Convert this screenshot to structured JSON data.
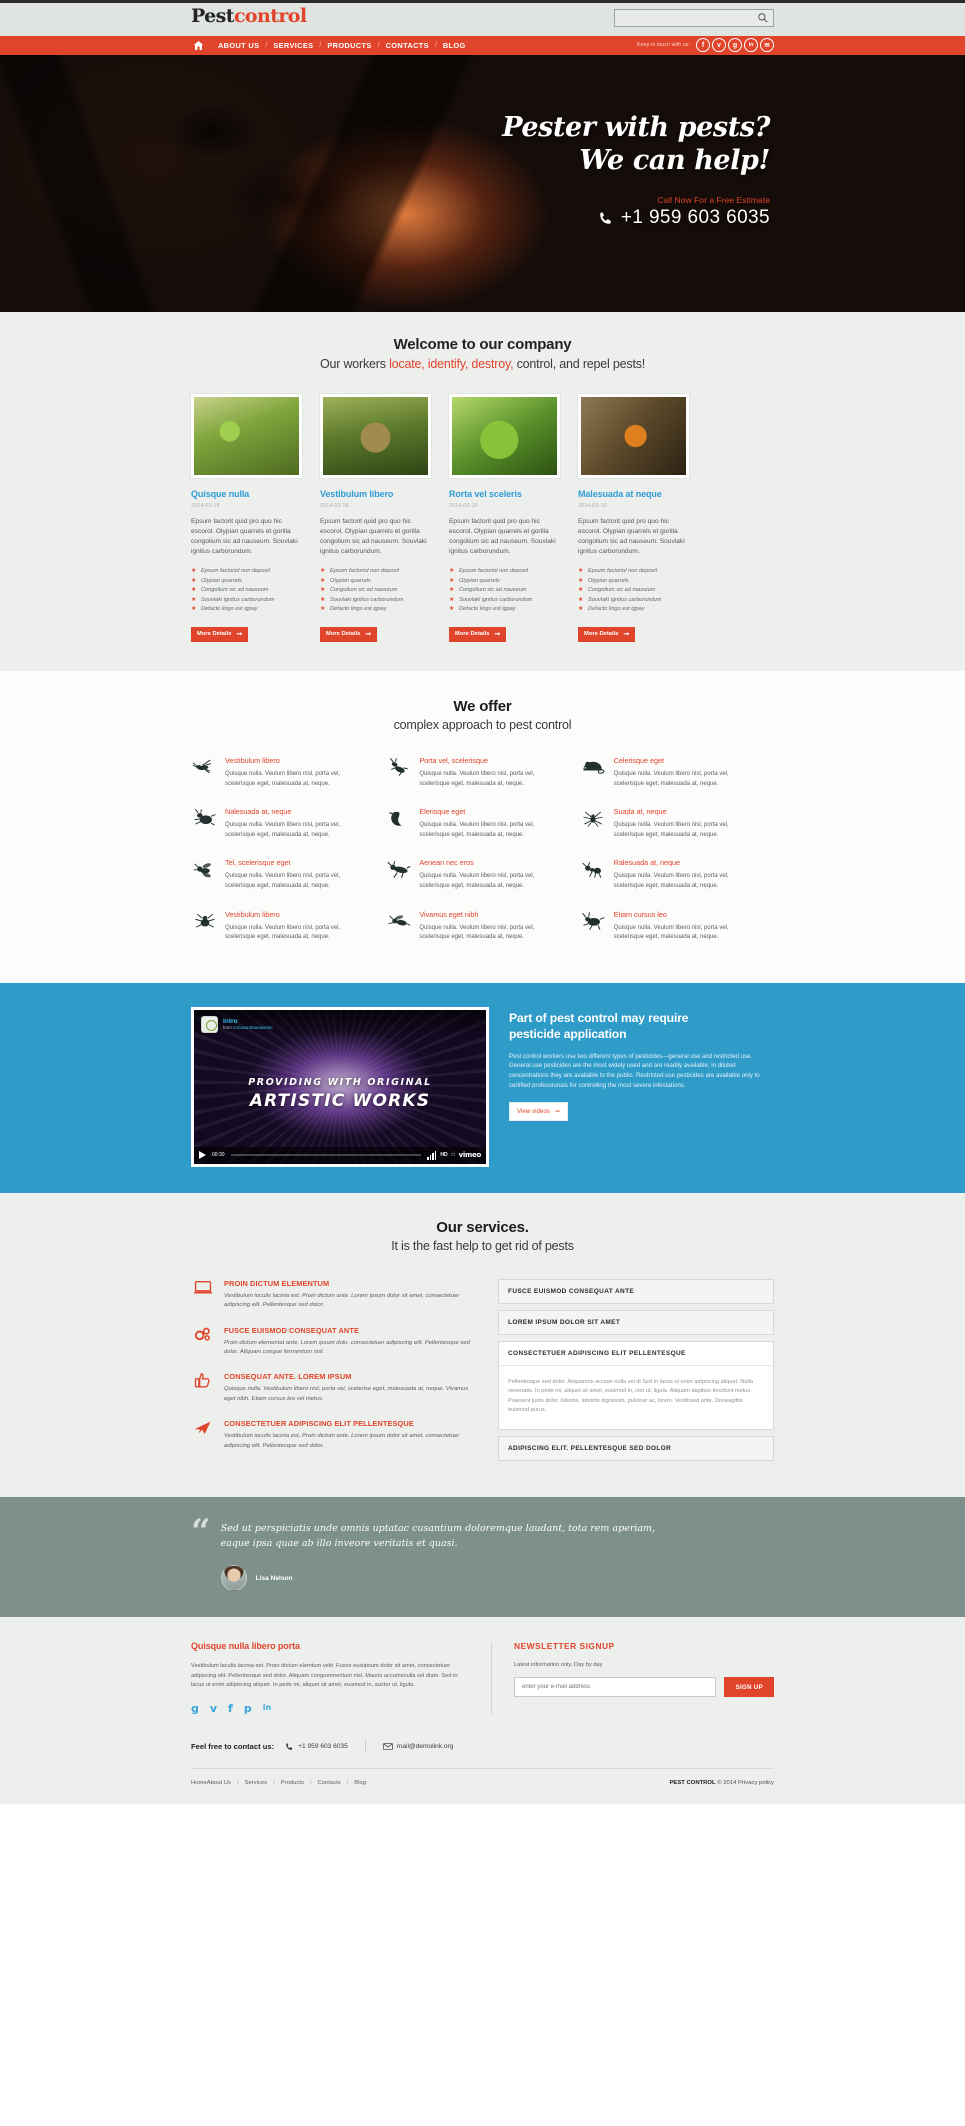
{
  "brand": {
    "name_part1": "Pest",
    "name_part2": "control"
  },
  "search": {
    "placeholder": "",
    "value": "",
    "icon": "search-icon"
  },
  "nav": {
    "home_icon": "home-icon",
    "items": [
      "ABOUT US",
      "SERVICES",
      "PRODUCTS",
      "CONTACTS",
      "BLOG"
    ],
    "separator": "/",
    "keep_in_touch": "Keep in touch with us:",
    "social": [
      {
        "name": "facebook",
        "glyph": "f"
      },
      {
        "name": "twitter",
        "glyph": "ᴠ"
      },
      {
        "name": "google-plus",
        "glyph": "g"
      },
      {
        "name": "linkedin",
        "glyph": "in"
      },
      {
        "name": "email",
        "glyph": "✉"
      }
    ]
  },
  "hero": {
    "title_line1": "Pester with pests?",
    "title_line2": "We can help!",
    "call_label": "Call Now For a Free Estimate",
    "phone": "+1 959 603 6035",
    "phone_icon": "phone-icon"
  },
  "welcome": {
    "heading": "Welcome to our company",
    "sub_pre": "Our workers ",
    "sub_hl": "locate, identify, destroy,",
    "sub_post": " control, and repel pests!",
    "cards": [
      {
        "title": "Quisque nulla",
        "date": "2014-03-18",
        "text": "Epsum factorit quid pro quo hic escorol. Olypian quarrels et gorilla congolium sic ad nauseum. Souvlaki ignitus carborundum.",
        "bullets": [
          "Epsum factoriol non deposit",
          "Olypian quarrels",
          "Congolium sic ad nauseum",
          "Souvlaki ignitus carborundum",
          "Defacto lingo est igpay"
        ],
        "button": "More Details"
      },
      {
        "title": "Vestibulum libero",
        "date": "2014-03-18",
        "text": "Epsum factorit quid pro quo hic escorol. Olypian quarrels et gorilla congolium sic ad nauseum. Souvlaki ignitus carborundum.",
        "bullets": [
          "Epsum factoriol non deposit",
          "Olypian quarrels",
          "Congolium sic ad nauseum",
          "Souvlaki ignitus carborundum",
          "Defacto lingo est igpay"
        ],
        "button": "More Details"
      },
      {
        "title": "Rorta vel sceleris",
        "date": "2014-03-18",
        "text": "Epsum factorit quid pro quo hic escorol. Olypian quarrels et gorilla congolium sic ad nauseum. Souvlaki ignitus carborundum.",
        "bullets": [
          "Epsum factoriol non deposit",
          "Olypian quarrels",
          "Congolium sic ad nauseum",
          "Souvlaki ignitus carborundum",
          "Defacto lingo est igpay"
        ],
        "button": "More Details"
      },
      {
        "title": "Malesuada at neque",
        "date": "2014-03-18",
        "text": "Epsum factorit quid pro quo hic escorol. Olypian quarrels et gorilla congolium sic ad nauseum. Souvlaki ignitus carborundum.",
        "bullets": [
          "Epsum factoriol non deposit",
          "Olypian quarrels",
          "Congolium sic ad nauseum",
          "Souvlaki ignitus carborundum",
          "Defacto lingo est igpay"
        ],
        "button": "More Details"
      }
    ]
  },
  "offer": {
    "heading": "We offer",
    "sub": "complex approach to pest control",
    "body": "Quisque nulla. Veulum libero nisl, porta vel, scelerisque eget, malesuada at, neque.",
    "items": [
      {
        "title": "Vestibulum libero",
        "icon": "mosquito-icon"
      },
      {
        "title": "Porta vel, scelerisque",
        "icon": "cricket-icon"
      },
      {
        "title": "Celerisque eget",
        "icon": "mouse-icon"
      },
      {
        "title": "Nalesuada at, neque",
        "icon": "beetle-icon"
      },
      {
        "title": "Elerisque eget",
        "icon": "pigeon-icon"
      },
      {
        "title": "Suada at, neque",
        "icon": "spider-icon"
      },
      {
        "title": "Tel, scelerisque eget",
        "icon": "fly-icon"
      },
      {
        "title": "Aenean nec eros",
        "icon": "grasshopper-icon"
      },
      {
        "title": "Ralesuada at, neque",
        "icon": "ant-icon"
      },
      {
        "title": "Vestibulum libero",
        "icon": "tick-icon"
      },
      {
        "title": "Vivamus eget nibh",
        "icon": "wasp-icon"
      },
      {
        "title": "Etiam cursus leo",
        "icon": "cockroach-icon"
      }
    ]
  },
  "video_block": {
    "player": {
      "title": "Intro",
      "from_label": "from",
      "from_author": "tomasandsaraweber",
      "overlay_line1": "PROVIDING WITH ORIGINAL",
      "overlay_line2": "ARTISTIC WORKS",
      "time": "00:30",
      "hd": "HD",
      "brand": "vimeo",
      "play_icon": "play-icon"
    },
    "heading_line1": "Part of pest control may require",
    "heading_line2": "pesticide application",
    "text": "Pest control workers use two different types of pesticides—general use and restricted use. General use pesticides are the most widely used and are readily available; in diluted concentrations they are available to the public. Restricted use pesticides are available only to certified professionals for controlling the most severe infestations.",
    "button": "View videos"
  },
  "services": {
    "heading": "Our services.",
    "sub": "It is the fast help to get rid of pests",
    "items": [
      {
        "icon": "laptop-icon",
        "title": "PROIN DICTUM ELEMENTUM",
        "text": "Vestibulum ioculis lacinia est. Proin dictum ante. Lorem ipsum dolor sit amet, consectetuer adipiscing elit. Pellentesque sed dolor."
      },
      {
        "icon": "gears-icon",
        "title": "FUSCE EUISMOD CONSEQUAT ANTE",
        "text": "Proin dictum elementat ante. Lorem ipsum dolo, consectetuer adipiscing elit. Pellentesque sed dolor. Allquam congue fermentum nisl."
      },
      {
        "icon": "thumbs-up-icon",
        "title": "CONSEQUAT ANTE. LOREM IPSUM",
        "text": "Quisque nulla. Vestibulum libero nisl, porta vel, scelerise eget, malesuada at, neque. Vivamus eget nibh. Etiam cursus leo vel metus."
      },
      {
        "icon": "airplane-icon",
        "title": "CONSECTETUER ADIPISCING ELIT PELLENTESQUE",
        "text": "Vestibulum ioculis lacinia est, Proin dictum ante. Lorem ipsum dolor sit amet, consectetuer adipiscing elit. Pellentesque sed dolor."
      }
    ],
    "accordion": [
      {
        "title": "FUSCE EUISMOD CONSEQUAT ANTE",
        "open": false,
        "body": ""
      },
      {
        "title": "LOREM IPSUM DOLOR SIT AMET",
        "open": false,
        "body": ""
      },
      {
        "title": "CONSECTETUER ADIPISCING ELIT PELLENTESQUE",
        "open": true,
        "body": "Pellentesque sed dolor. Aliquamris accsan nulla vel di Sed in lacus ut enim adipiscing aliquet. Nulla venenatis. In pede mi, aliquet sit amet, euismod in, ctor ut, ligula. Aliquam dapibus tincidunt metus. Praesent justo dolor, lobortis, lobortis dignissim, pulvinar ac, lorem. Vestibsed ante. Doneagittis euismod purus."
      },
      {
        "title": "ADIPISCING ELIT. PELLENTESQUE SED DOLOR",
        "open": false,
        "body": ""
      }
    ]
  },
  "testimonial": {
    "quote_mark": "“",
    "text_line1": "Sed ut perspiciatis unde omnis uptatac cusantium doloremque laudant, tota rem aperiam,",
    "text_line2": "eaque ipsa quae ab illo inveore veritatis et quasi.",
    "author": "Lisa Nelson"
  },
  "footer": {
    "left": {
      "heading": "Quisque nulla libero porta",
      "text": "Vestibulum laculis lacinia est. Proin dictum elemtum velit. Fusce euisipsum dolor sit amet, consectetuer adipiscing elit. Pellentesque sed dolor. Aliquam conguermentum nisl. Mauris accumsnulla vel diam. Sed in lacus ut enim adipiscing aliquet. In pede mi, aliquet sit amet, euismod in, auctor ut, ligula.",
      "social": [
        {
          "name": "google-plus",
          "glyph": "g"
        },
        {
          "name": "twitter",
          "glyph": "ᴠ"
        },
        {
          "name": "facebook",
          "glyph": "f"
        },
        {
          "name": "pinterest",
          "glyph": "p"
        },
        {
          "name": "linkedin",
          "glyph": "in"
        }
      ]
    },
    "newsletter": {
      "heading": "NEWSLETTER SIGNUP",
      "note": "Latest information only. Day by day",
      "placeholder": "enter your e-mail address",
      "value": "",
      "button": "SIGN UP"
    },
    "contact": {
      "label": "Feel free to contact us:",
      "phone": "+1 959 603 6035",
      "email": "mail@demolink.org",
      "phone_icon": "phone-icon",
      "mail_icon": "envelope-icon"
    },
    "links": [
      "Home",
      "About Us",
      "Services",
      "Products",
      "Contacts",
      "Blog"
    ],
    "copyright_brand": "PEST CONTROL",
    "copyright_text": "© 2014 Privacy policy"
  },
  "colors": {
    "accent": "#e0452c",
    "blue": "#2f9bc9",
    "link_blue": "#2f9bd6",
    "header_bg": "#dfe4e0",
    "testimonial_bg": "#7e908c"
  }
}
